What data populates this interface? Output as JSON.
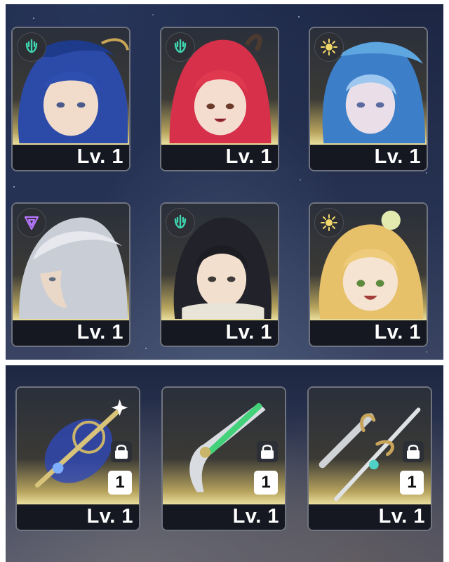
{
  "characters": [
    {
      "level": "Lv. 1",
      "element": "wind-element-icon",
      "element_color": "#3fd6b0"
    },
    {
      "level": "Lv. 1",
      "element": "wind-element-icon",
      "element_color": "#3fd6b0"
    },
    {
      "level": "Lv. 1",
      "element": "light-element-icon",
      "element_color": "#f3d86a"
    },
    {
      "level": "Lv. 1",
      "element": "void-element-icon",
      "element_color": "#b777ff"
    },
    {
      "level": "Lv. 1",
      "element": "wind-element-icon",
      "element_color": "#3fd6b0"
    },
    {
      "level": "Lv. 1",
      "element": "light-element-icon",
      "element_color": "#f3d86a"
    }
  ],
  "weapons": [
    {
      "level": "Lv. 1",
      "rank": "1",
      "locked": true,
      "accent": "#4f67ff"
    },
    {
      "level": "Lv. 1",
      "rank": "1",
      "locked": true,
      "accent": "#43d27a"
    },
    {
      "level": "Lv. 1",
      "rank": "1",
      "locked": true,
      "accent": "#d9b46a"
    }
  ]
}
